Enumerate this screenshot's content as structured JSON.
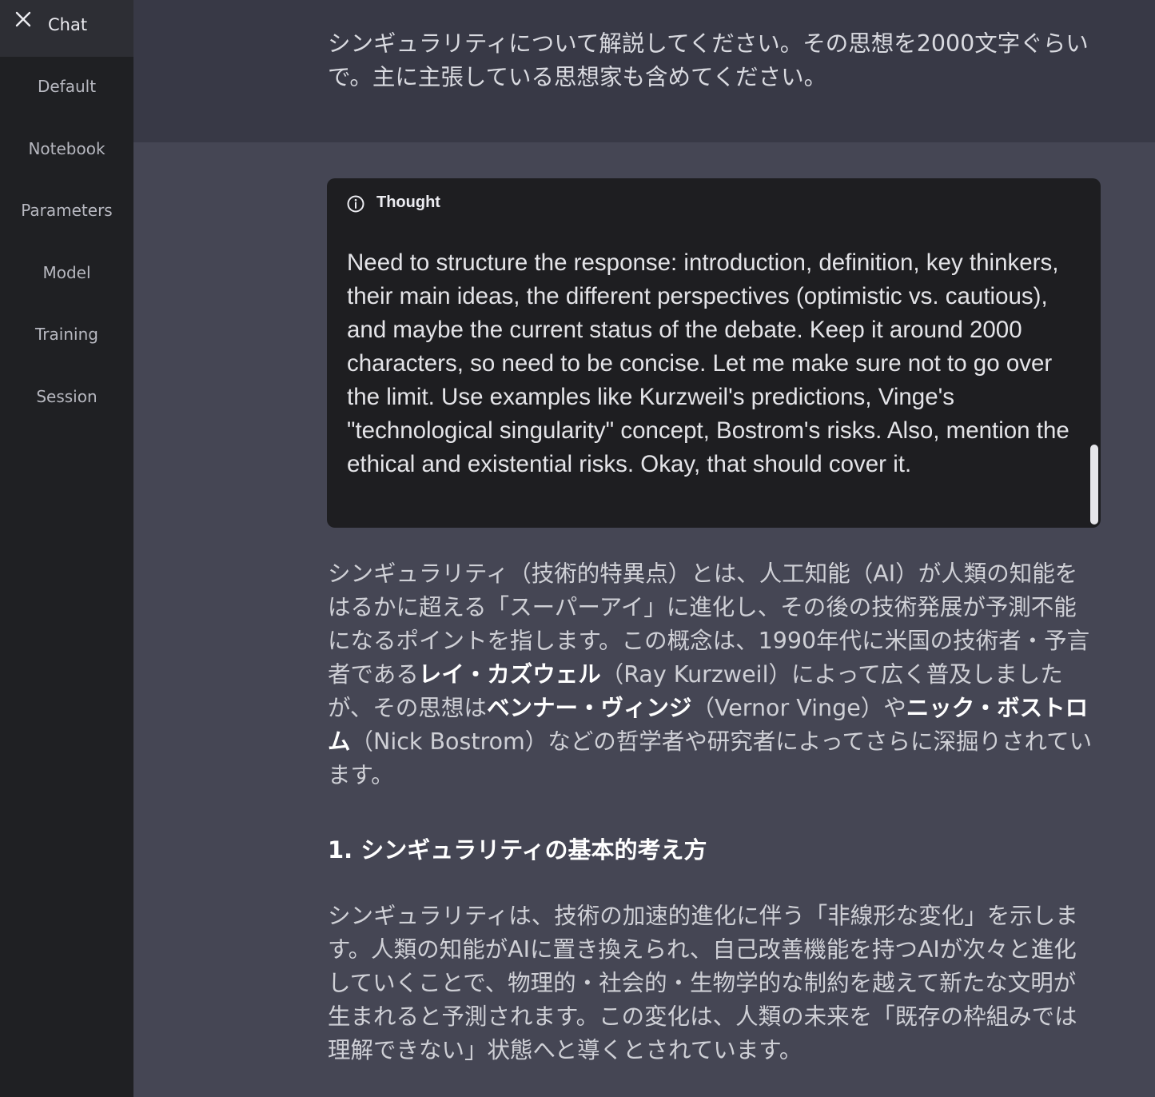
{
  "sidebar": {
    "active_tab": "Chat",
    "items": [
      {
        "label": "Default"
      },
      {
        "label": "Notebook"
      },
      {
        "label": "Parameters"
      },
      {
        "label": "Model"
      },
      {
        "label": "Training"
      },
      {
        "label": "Session"
      }
    ]
  },
  "conversation": {
    "user_message": "シンギュラリティについて解説してください。その思想を2000文字ぐらいで。主に主張している思想家も含めてください。",
    "thought": {
      "title": "Thought",
      "text": "Need to structure the response: introduction, definition, key thinkers, their main ideas, the different perspectives (optimistic vs. cautious), and maybe the current status of the debate. Keep it around 2000 characters, so need to be concise. Let me make sure not to go over the limit. Use examples like Kurzweil's predictions, Vinge's \"technological singularity\" concept, Bostrom's risks. Also, mention the ethical and existential risks. Okay, that should cover it."
    },
    "answer": {
      "intro_1": "シンギュラリティ（技術的特異点）とは、人工知能（AI）が人類の知能をはるかに超える「スーパーアイ」に進化し、その後の技術発展が予測不能になるポイントを指します。この概念は、1990年代に米国の技術者・予言者である",
      "kurzweil": "レイ・カズウェル",
      "intro_2": "（Ray Kurzweil）によって広く普及しましたが、その思想は",
      "vinge": "ベンナー・ヴィンジ",
      "intro_3": "（Vernor Vinge）や",
      "bostrom": "ニック・ボストロム",
      "intro_4": "（Nick Bostrom）などの哲学者や研究者によってさらに深掘りされています。",
      "section_1_heading": "1. シンギュラリティの基本的考え方",
      "section_1_body": "シンギュラリティは、技術の加速的進化に伴う「非線形な変化」を示します。人類の知能がAIに置き換えられ、自己改善機能を持つAIが次々と進化していくことで、物理的・社会的・生物学的な制約を越えて新たな文明が生まれると予測されます。この変化は、人類の未来を「既存の枠組みでは理解できない」状態へと導くとされています。"
    }
  }
}
